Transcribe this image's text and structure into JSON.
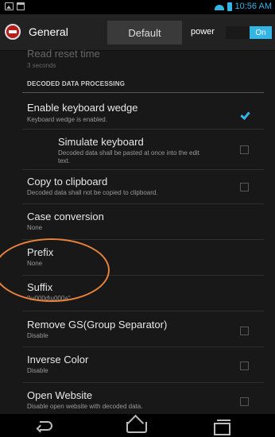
{
  "status_bar": {
    "time": "10:56 AM",
    "icons": [
      "image-icon",
      "store-icon",
      "wifi-icon",
      "battery-icon"
    ],
    "accent_color": "#33b5e5"
  },
  "action_bar": {
    "app_icon": "app-logo-icon",
    "title": "General",
    "tab_label": "Default",
    "power_label": "power",
    "toggle_label": "On"
  },
  "settings": {
    "read_reset_time": {
      "title": "Read reset time",
      "summary": "3 seconds"
    },
    "section_header": "DECODED DATA PROCESSING",
    "keyboard_wedge": {
      "title": "Enable keyboard wedge",
      "summary": "Keyboard wedge is enabled.",
      "checked": true
    },
    "simulate_keyboard": {
      "title": "Simulate keyboard",
      "summary_line1": "Decoded data shall be pasted at once into the edit",
      "summary_line2": "text.",
      "checked": false
    },
    "copy_clipboard": {
      "title": "Copy to clipboard",
      "summary": "Decoded data shall not be copied to clipboard.",
      "checked": false
    },
    "case_conversion": {
      "title": "Case conversion",
      "summary": "None"
    },
    "prefix": {
      "title": "Prefix",
      "summary": "None"
    },
    "suffix": {
      "title": "Suffix",
      "summary": "\"\\u000d\\u000a\""
    },
    "remove_gs": {
      "title": "Remove GS(Group Separator)",
      "summary": "Disable",
      "checked": false
    },
    "inverse_color": {
      "title": "Inverse Color",
      "summary": "Disable",
      "checked": false
    },
    "open_website": {
      "title": "Open Website",
      "summary": "Disable open website with decoded data.",
      "checked": false
    }
  },
  "nav_bar": {
    "icons": [
      "back-icon",
      "home-icon",
      "recent-apps-icon"
    ]
  },
  "annotation_color": "#e8823a"
}
